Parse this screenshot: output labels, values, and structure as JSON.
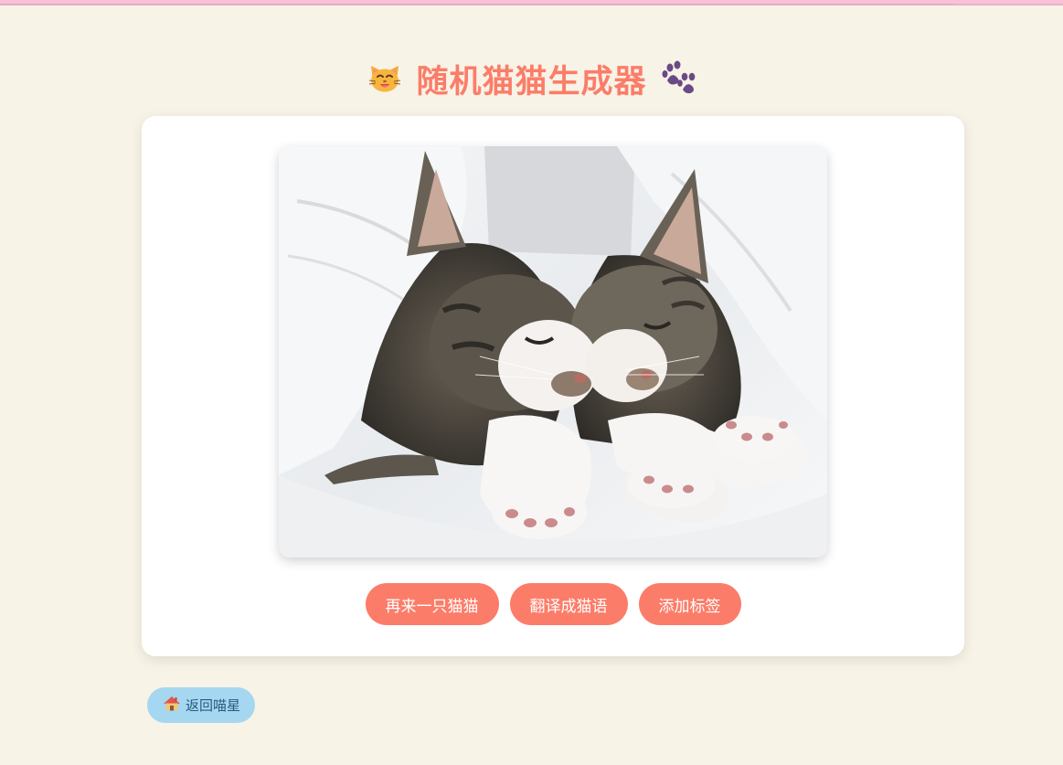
{
  "header": {
    "title": "随机猫猫生成器",
    "left_icon": "cat-face-icon",
    "right_icon": "paw-prints-icon"
  },
  "card": {
    "image": {
      "subject": "cat-photo",
      "alt": ""
    },
    "buttons": [
      {
        "label": "再来一只猫猫"
      },
      {
        "label": "翻译成猫语"
      },
      {
        "label": "添加标签"
      }
    ]
  },
  "back_button": {
    "label": "返回喵星",
    "icon": "house-icon"
  },
  "colors": {
    "background": "#f8f3e7",
    "accent": "#fb7d69",
    "title": "#fb7d69",
    "back_button_bg": "#a6d7f0",
    "back_button_text": "#275a82",
    "top_bar": "#f6c2d8"
  }
}
